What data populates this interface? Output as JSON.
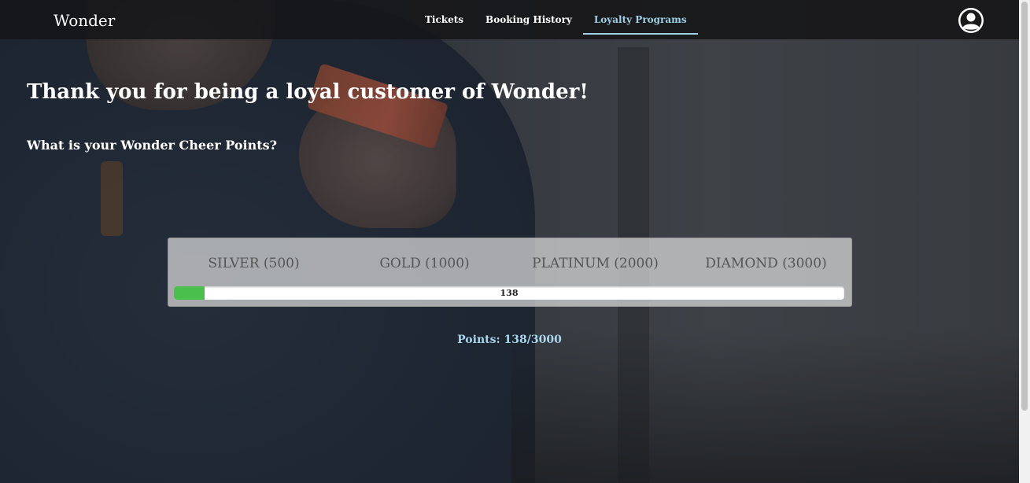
{
  "nav": {
    "brand": "Wonder",
    "links": [
      "Tickets",
      "Booking History",
      "Loyalty Programs"
    ],
    "active_link": "Loyalty Programs",
    "profile_icon": "user-circle-icon"
  },
  "main": {
    "title": "Thank you for being a loyal customer of Wonder!",
    "subtitle": "What is your Wonder Cheer Points?",
    "tiers": [
      "SILVER (500)",
      "GOLD (1000)",
      "PLATINUM (2000)",
      "DIAMOND (3000)"
    ],
    "progress": {
      "value": 138,
      "max": 3000,
      "label": "138"
    },
    "points_text": "Points: 138/3000"
  },
  "colors": {
    "accent": "#9fd0e6",
    "progress_fill": "#4bbf4b"
  }
}
